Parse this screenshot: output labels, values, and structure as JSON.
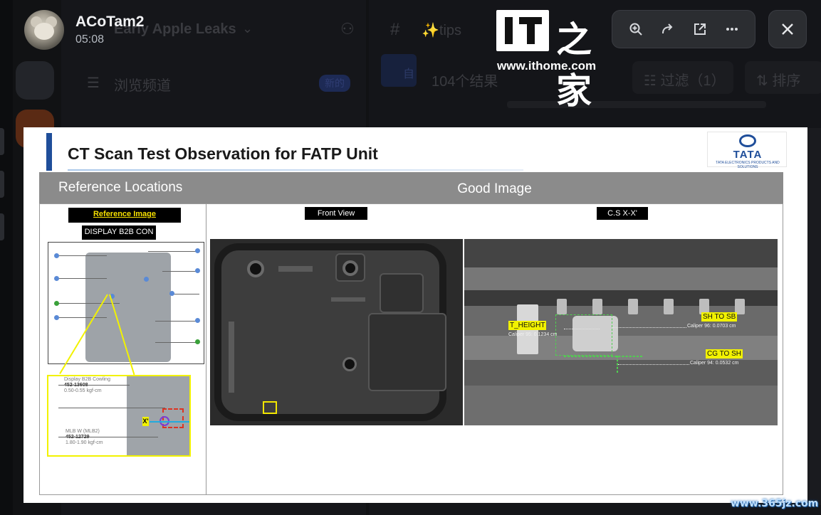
{
  "background": {
    "server_name": "Early Apple Leaks",
    "browse_channels": "浏览频道",
    "new_badge": "新的",
    "channel_name": "tips",
    "results_count": "104个结果",
    "filter_label": "过滤（1）",
    "sort_label": "排序",
    "tab_char": "自"
  },
  "viewer": {
    "username": "ACoTam2",
    "timestamp": "05:08",
    "toolbar": {
      "zoom_icon": "zoom-in-icon",
      "forward_icon": "forward-icon",
      "open_icon": "open-external-icon",
      "more_icon": "more-icon",
      "close_icon": "close-icon"
    }
  },
  "watermark": {
    "logo_text": "IT之家",
    "url": "www.ithome.com",
    "corner": "www.365jz.com"
  },
  "slide": {
    "title": "CT Scan Test Observation for FATP Unit",
    "brand": "TATA",
    "brand_sub": "TATA ELECTRONICS PRODUCTS AND SOLUTIONS",
    "header_left": "Reference Locations",
    "header_right": "Good Image",
    "reference_image_tag": "Reference Image",
    "display_tag": "DISPLAY B2B CON",
    "front_view_tag": "Front View",
    "csxx_tag": "C.S X-X'",
    "zoom": {
      "part1_name": "Display B2B Cowling",
      "part1_number": "452-13608",
      "part1_torque": "0.50-0.55 kgf-cm",
      "part2_name": "MLB W (MLB2)",
      "part2_number": "452-12729",
      "part2_torque": "1.80-1.90 kgf-cm",
      "x_left": "X'",
      "x_right": "X"
    },
    "ct_labels": {
      "t_height": "T_HEIGHT",
      "t_height_caliper": "Caliper 95: 0.1234 cm",
      "sh_to_sb": "SH TO SB",
      "sh_to_sb_caliper": "Caliper 96: 0.0703 cm",
      "cg_to_sh": "CG TO SH",
      "cg_to_sh_caliper": "Caliper 94: 0.0532 cm"
    }
  }
}
